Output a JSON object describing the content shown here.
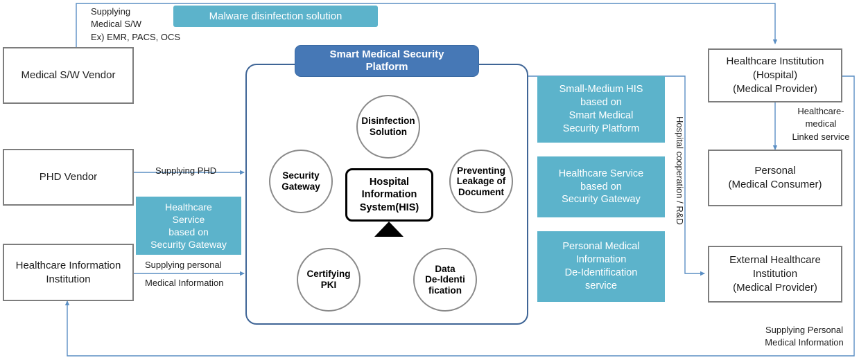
{
  "diagram": {
    "title": "Smart Medical Security Platform ecosystem diagram",
    "colors": {
      "teal": "#5cb3cb",
      "platform_blue": "#4678b6",
      "box_border_grey": "#7d7d7d",
      "wire_blue": "#5b8fc4",
      "platform_frame": "#3f6596"
    }
  },
  "banner": {
    "malware_label": "Malware disinfection solution"
  },
  "platform": {
    "title": "Smart Medical Security\nPlatform",
    "center_node": "Hospital\nInformation\nSystem(HIS)",
    "nodes": [
      {
        "id": "disinfection-solution",
        "label": "Disinfection\nSolution"
      },
      {
        "id": "preventing-leakage-of-document",
        "label": "Preventing\nLeakage of\nDocument"
      },
      {
        "id": "data-de-identification",
        "label": "Data\nDe-Identi\nfication"
      },
      {
        "id": "certifying-pki",
        "label": "Certifying\nPKI"
      },
      {
        "id": "security-gateway",
        "label": "Security\nGateway"
      }
    ]
  },
  "left_column": {
    "boxes": [
      {
        "id": "medical-sw-vendor",
        "label": "Medical S/W Vendor"
      },
      {
        "id": "phd-vendor",
        "label": "PHD Vendor"
      },
      {
        "id": "healthcare-information-institution",
        "label": "Healthcare Information\nInstitution"
      }
    ],
    "teal_callout": "Healthcare\nService\nbased on\nSecurity Gateway"
  },
  "right_column": {
    "boxes": [
      {
        "id": "healthcare-institution-hospital",
        "label": "Healthcare Institution\n(Hospital)\n(Medical Provider)"
      },
      {
        "id": "personal-medical-consumer",
        "label": "Personal\n(Medical Consumer)"
      },
      {
        "id": "external-healthcare-institution",
        "label": "External Healthcare\nInstitution\n(Medical Provider)"
      }
    ]
  },
  "teal_callouts": [
    {
      "id": "small-medium-his",
      "label": "Small-Medium HIS\nbased on\nSmart Medical\nSecurity Platform"
    },
    {
      "id": "healthcare-service-security-gateway",
      "label": "Healthcare Service\nbased on\nSecurity Gateway"
    },
    {
      "id": "personal-medical-deidentification",
      "label": "Personal Medical\nInformation\nDe-Identification\nservice"
    }
  ],
  "annotations": {
    "supplying_medical_sw": "Supplying\nMedical  S/W\nEx) EMR, PACS,  OCS",
    "supplying_phd": "Supplying PHD",
    "supplying_personal": "Supplying  personal",
    "medical_information": "Medical  Information",
    "hospital_cooperation": "Hospital  cooperation  /  R&D",
    "healthcare_medical_linked": "Healthcare-\nmedical\nLinked  service",
    "supplying_personal_medical": "Supplying Personal\nMedical  Information"
  }
}
